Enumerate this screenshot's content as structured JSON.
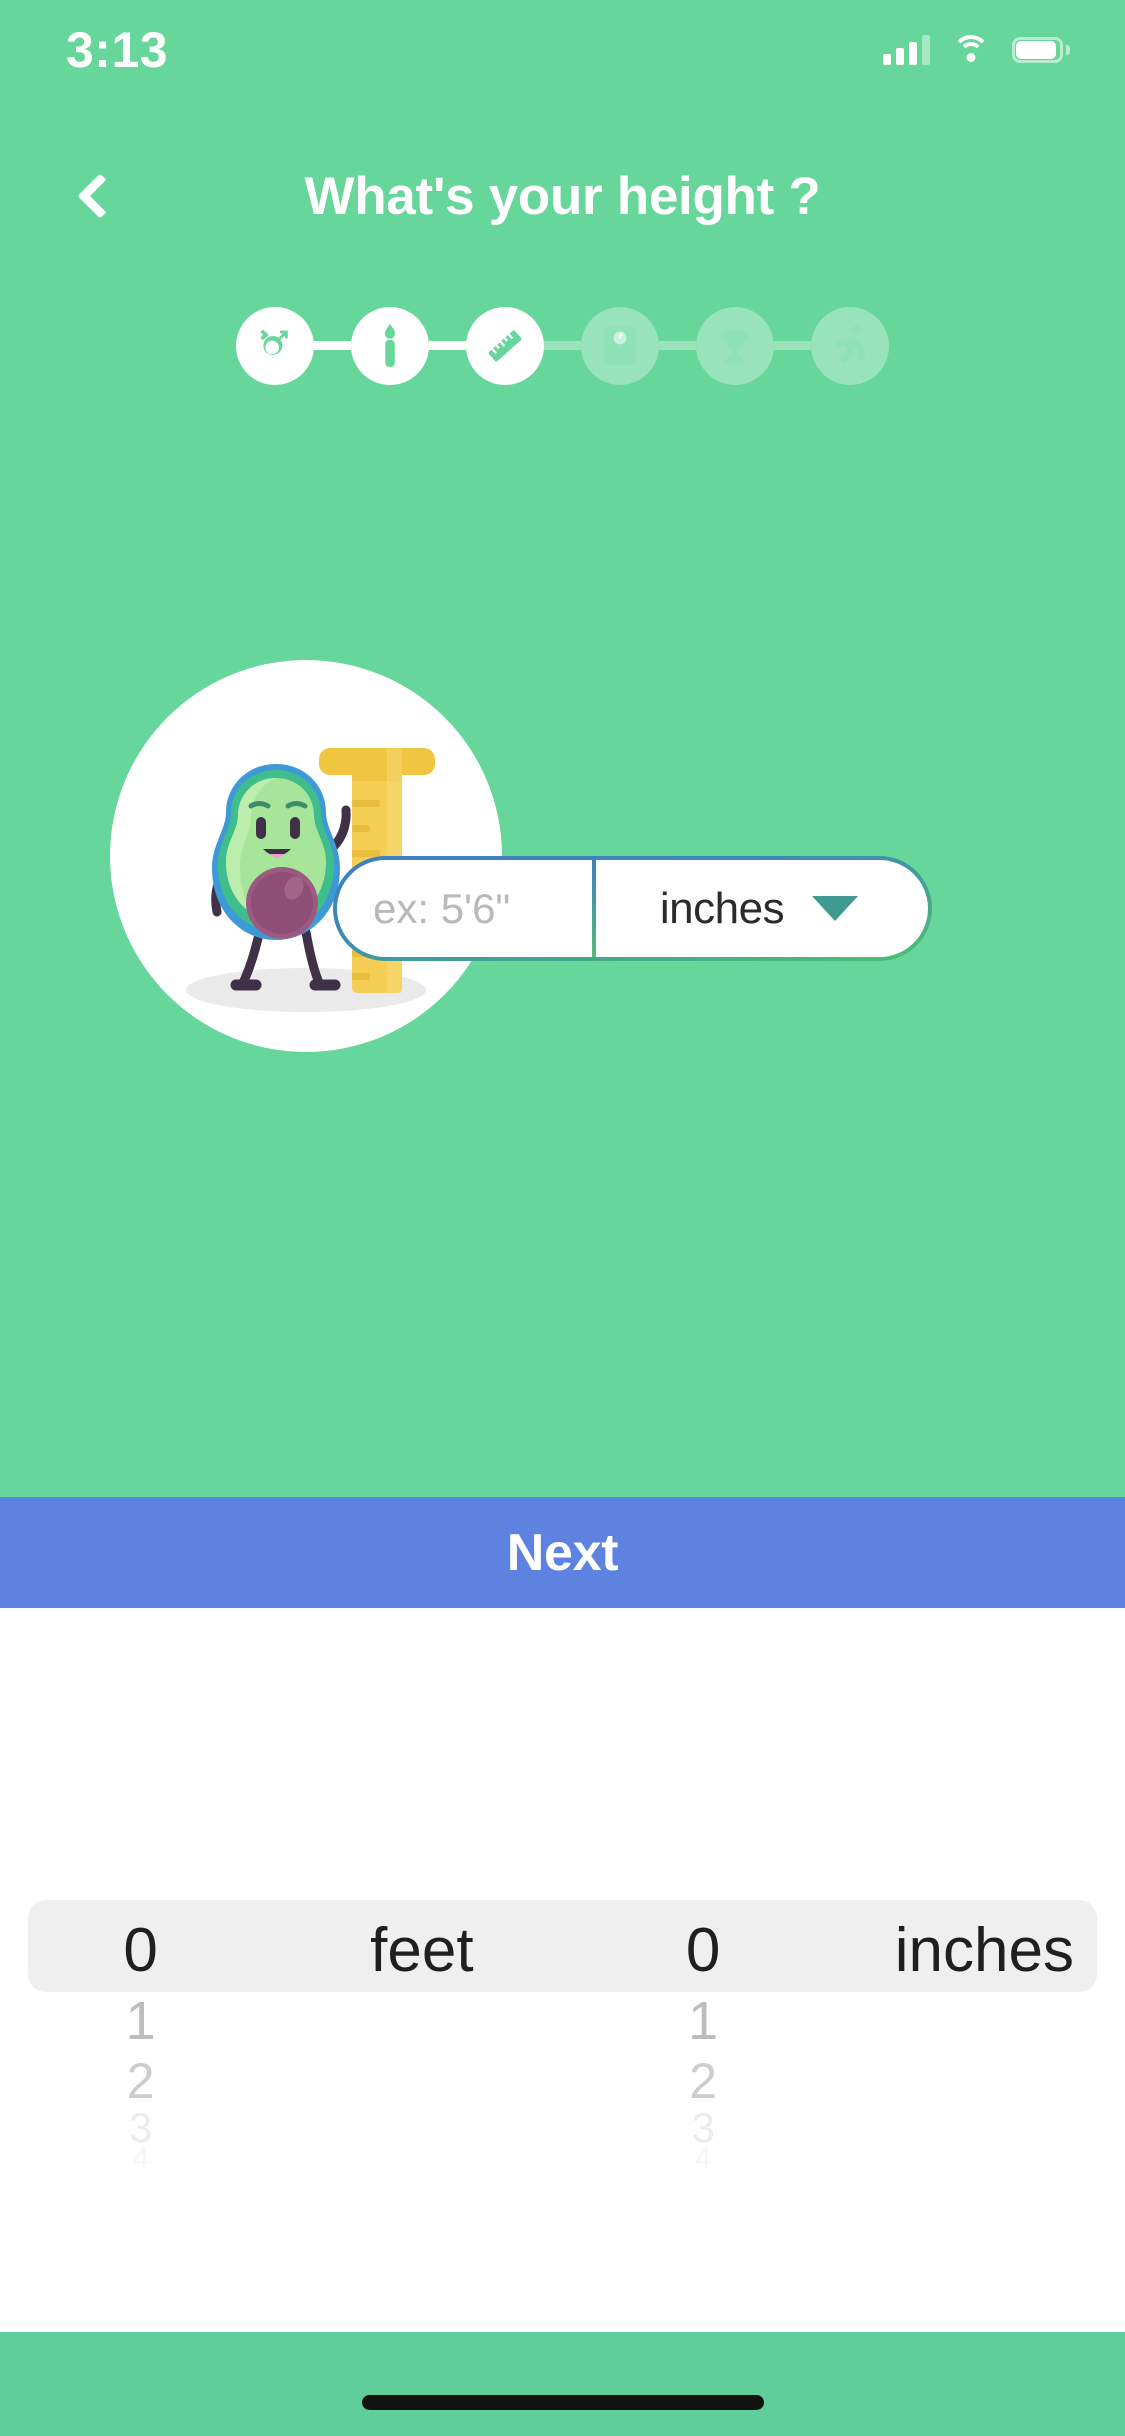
{
  "status_bar": {
    "time": "3:13",
    "signal_icon": "cellular-signal-icon",
    "wifi_icon": "wifi-icon",
    "battery_icon": "battery-icon",
    "signal_bars_filled": 3,
    "signal_bars_total": 4
  },
  "nav": {
    "back_icon": "chevron-left-icon",
    "title": "What's your height ?"
  },
  "stepper": {
    "steps": [
      {
        "id": "gender",
        "icon": "gender-symbols-icon",
        "state": "active"
      },
      {
        "id": "age",
        "icon": "candle-icon",
        "state": "active"
      },
      {
        "id": "height",
        "icon": "ruler-icon",
        "state": "active"
      },
      {
        "id": "weight",
        "icon": "weight-scale-icon",
        "state": "inactive"
      },
      {
        "id": "goal",
        "icon": "trophy-icon",
        "state": "inactive"
      },
      {
        "id": "activity",
        "icon": "running-person-icon",
        "state": "inactive"
      }
    ]
  },
  "illustration": {
    "name": "avocado-with-ruler-illustration",
    "character": "avocado-character",
    "prop": "measuring-ruler"
  },
  "height_field": {
    "value": "",
    "placeholder": "ex: 5'6\"",
    "unit_label": "inches",
    "unit_caret_icon": "chevron-down-icon"
  },
  "primary_action": {
    "label": "Next"
  },
  "picker": {
    "feet_unit": "feet",
    "inches_unit": "inches",
    "feet_values": [
      "0",
      "1",
      "2",
      "3",
      "4"
    ],
    "inches_values": [
      "0",
      "1",
      "2",
      "3",
      "4"
    ],
    "selected_feet": "0",
    "selected_inches": "0"
  },
  "bottom_bar": {
    "home_indicator": "home-indicator"
  },
  "colors": {
    "background_green": "#66D69A",
    "next_blue": "#5E82E0",
    "bottom_green": "#5FCE9B",
    "picker_band": "#EFEFEF",
    "pill_gradient_start": "#3D7FC4",
    "pill_gradient_end": "#4FBF74"
  }
}
